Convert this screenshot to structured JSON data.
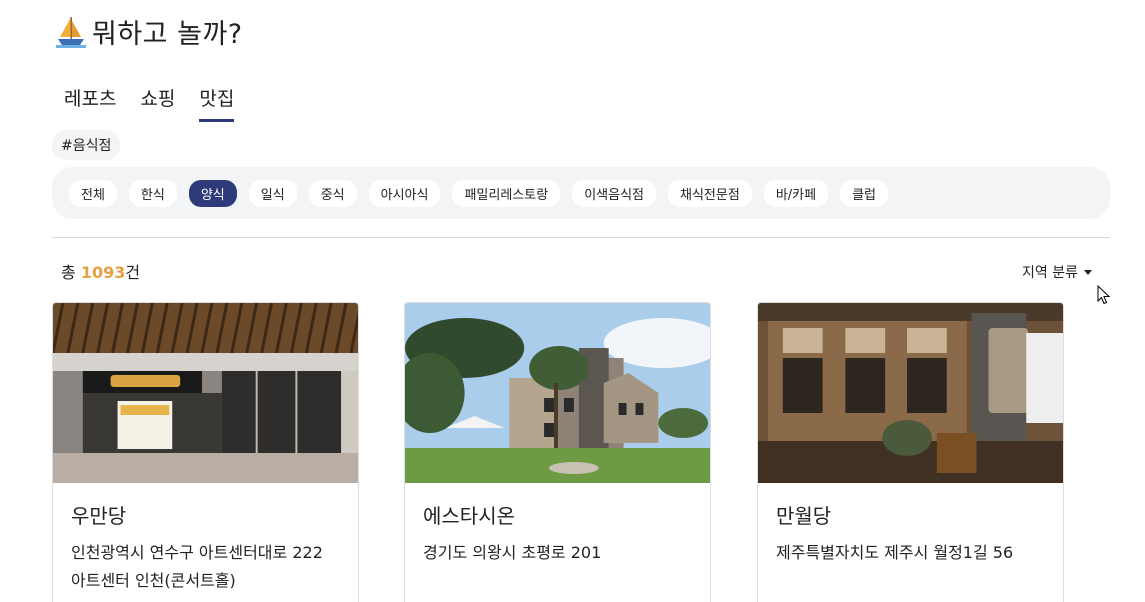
{
  "site": {
    "title": "뭐하고 놀까?",
    "logo_icon": "sailboat-icon"
  },
  "tabs": [
    {
      "label": "레포츠",
      "active": false
    },
    {
      "label": "쇼핑",
      "active": false
    },
    {
      "label": "맛집",
      "active": true
    }
  ],
  "tag": "#음식점",
  "filters": [
    {
      "label": "전체",
      "active": false
    },
    {
      "label": "한식",
      "active": false
    },
    {
      "label": "양식",
      "active": true
    },
    {
      "label": "일식",
      "active": false
    },
    {
      "label": "중식",
      "active": false
    },
    {
      "label": "아시아식",
      "active": false
    },
    {
      "label": "패밀리레스토랑",
      "active": false
    },
    {
      "label": "이색음식점",
      "active": false
    },
    {
      "label": "채식전문점",
      "active": false
    },
    {
      "label": "바/카페",
      "active": false
    },
    {
      "label": "클럽",
      "active": false
    }
  ],
  "results": {
    "prefix": "총",
    "count": "1093",
    "suffix": "건"
  },
  "region_dropdown": {
    "label": "지역 분류"
  },
  "cards": [
    {
      "title": "우만당",
      "address": "인천광역시 연수구 아트센터대로 222 아트센터 인천(콘서트홀)"
    },
    {
      "title": "에스타시온",
      "address": "경기도 의왕시 초평로 201"
    },
    {
      "title": "만월당",
      "address": "제주특별자치도 제주시 월정1길 56"
    }
  ],
  "colors": {
    "accent": "#2f3a7a",
    "count": "#e8a044",
    "chip_bg": "#f3f4f6"
  }
}
